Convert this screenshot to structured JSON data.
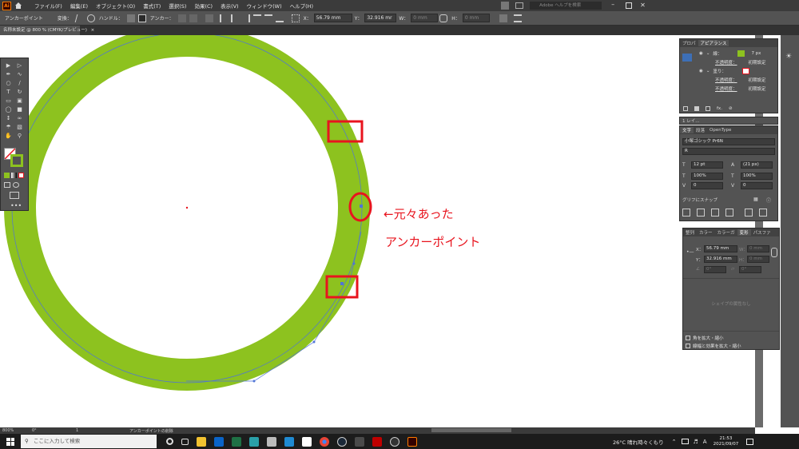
{
  "menubar": {
    "items": [
      "ファイル(F)",
      "編集(E)",
      "オブジェクト(O)",
      "書式(T)",
      "選択(S)",
      "効果(C)",
      "表示(V)",
      "ウィンドウ(W)",
      "ヘルプ(H)"
    ],
    "search_placeholder": "Adobe ヘルプを検索"
  },
  "controlbar": {
    "mode_label": "アンカーポイント",
    "transform_label": "変換：",
    "handle_label": "ハンドル：",
    "anchor_label": "アンカー：",
    "x_label": "X：",
    "x_value": "56.79 mm",
    "y_label": "Y：",
    "y_value": "32.916 mr",
    "w_label": "W：",
    "w_value": "0 mm",
    "h_label": "H：",
    "h_value": "0 mm"
  },
  "document": {
    "tab_label": "名称未設定 @ 800 % (CMYK/プレビュー)"
  },
  "annotation": {
    "line1": "←元々あった",
    "line2": "アンカーポイント"
  },
  "colors": {
    "stroke_green": "#8dc21f",
    "path_blue": "#4f74d6",
    "annotation_red": "#e8141e"
  },
  "appearance_panel": {
    "tabs": [
      "プロパ",
      "アピアランス"
    ],
    "stroke_label": "線：",
    "stroke_value": "7 px",
    "opacity_label": "不透明度：",
    "opacity_value": "初期設定",
    "fill_label": "塗り：",
    "opacity2_label": "不透明度：",
    "opacity2_value": "初期設定",
    "opacity3_label": "不透明度：",
    "opacity3_value": "初期設定",
    "fx_label": "fx."
  },
  "layers_tab": "1 レイ...",
  "character_panel": {
    "tabs": [
      "文字",
      "段落",
      "OpenType"
    ],
    "font_family": "小塚ゴシック Pr6N",
    "font_style": "R",
    "font_size": "12 pt",
    "leading": "(21 px)",
    "vscale": "100%",
    "hscale": "100%",
    "kerning": "0",
    "tracking": "0",
    "snap_label": "グリフにスナップ"
  },
  "transform_panel": {
    "tabs": [
      "整列",
      "カラー",
      "カラーガ",
      "変形",
      "パスファ"
    ],
    "x_label": "X：",
    "x_value": "56.79 mm",
    "y_label": "Y：",
    "y_value": "32.916 mm",
    "w_label": "W：",
    "w_value": "0 mm",
    "h_label": "H：",
    "h_value": "0 mm",
    "angle_value": "0°",
    "shear_value": "0°",
    "shape_props": "シェイプの属性なし",
    "checkbox1": "角を拡大・縮小",
    "checkbox2": "線幅と効果を拡大・縮小"
  },
  "statusbar": {
    "zoom": "800%",
    "angle": "0°",
    "artboard": "1",
    "tool_info": "アンカーポイントの削除"
  },
  "taskbar": {
    "search_placeholder": "ここに入力して検索",
    "weather": "26°C 晴れ時々くもり",
    "time": "21:53",
    "date": "2021/09/07"
  }
}
